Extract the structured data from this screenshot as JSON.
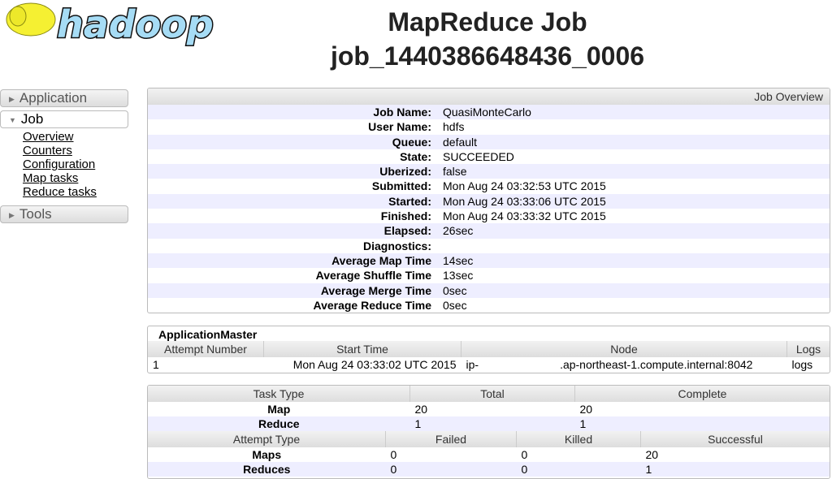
{
  "logo": {
    "text": "hadoop"
  },
  "title": {
    "line1": "MapReduce Job",
    "line2": "job_1440386648436_0006"
  },
  "nav": {
    "application": "Application",
    "job": "Job",
    "tools": "Tools",
    "job_items": [
      "Overview",
      "Counters",
      "Configuration",
      "Map tasks",
      "Reduce tasks"
    ]
  },
  "overview": {
    "header": "Job Overview",
    "rows": [
      {
        "k": "Job Name:",
        "v": "QuasiMonteCarlo"
      },
      {
        "k": "User Name:",
        "v": "hdfs"
      },
      {
        "k": "Queue:",
        "v": "default"
      },
      {
        "k": "State:",
        "v": "SUCCEEDED"
      },
      {
        "k": "Uberized:",
        "v": "false"
      },
      {
        "k": "Submitted:",
        "v": "Mon Aug 24 03:32:53 UTC 2015"
      },
      {
        "k": "Started:",
        "v": "Mon Aug 24 03:33:06 UTC 2015"
      },
      {
        "k": "Finished:",
        "v": "Mon Aug 24 03:33:32 UTC 2015"
      },
      {
        "k": "Elapsed:",
        "v": "26sec"
      },
      {
        "k": "Diagnostics:",
        "v": ""
      },
      {
        "k": "Average Map Time",
        "v": "14sec"
      },
      {
        "k": "Average Shuffle Time",
        "v": "13sec"
      },
      {
        "k": "Average Merge Time",
        "v": "0sec"
      },
      {
        "k": "Average Reduce Time",
        "v": "0sec"
      }
    ]
  },
  "am": {
    "title": "ApplicationMaster",
    "headers": [
      "Attempt Number",
      "Start Time",
      "Node",
      "Logs"
    ],
    "row": {
      "attempt": "1",
      "start": "Mon Aug 24 03:33:02 UTC 2015",
      "node_a": "ip-",
      "node_b": ".ap-northeast-1.compute.internal:8042",
      "logs": "logs"
    }
  },
  "tasks": {
    "headers": [
      "Task Type",
      "Total",
      "Complete"
    ],
    "rows": [
      {
        "type": "Map",
        "total": "20",
        "complete": "20"
      },
      {
        "type": "Reduce",
        "total": "1",
        "complete": "1"
      }
    ],
    "attempt_headers": [
      "Attempt Type",
      "Failed",
      "Killed",
      "Successful"
    ],
    "attempts": [
      {
        "type": "Maps",
        "failed": "0",
        "killed": "0",
        "successful": "20"
      },
      {
        "type": "Reduces",
        "failed": "0",
        "killed": "0",
        "successful": "1"
      }
    ]
  }
}
